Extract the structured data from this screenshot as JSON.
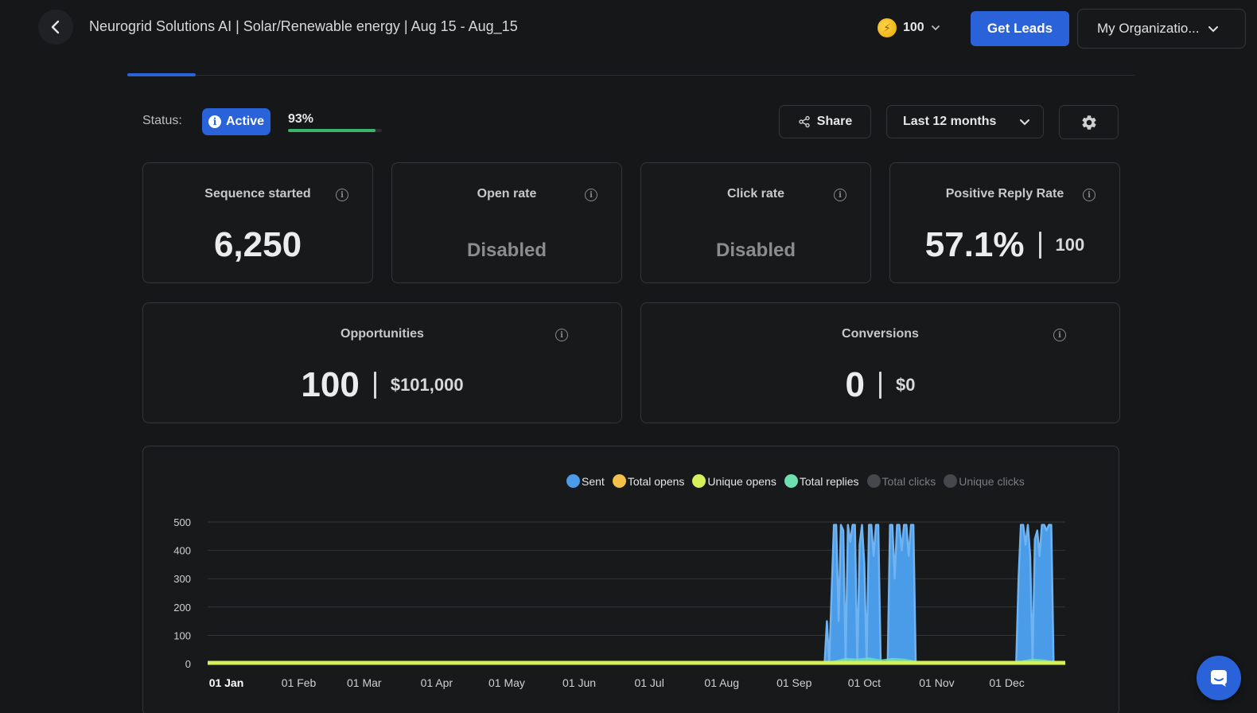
{
  "header": {
    "title": "Neurogrid Solutions AI | Solar/Renewable energy | Aug 15 - Aug_15",
    "credits": "100",
    "get_leads_label": "Get Leads",
    "org_label": "My Organizatio..."
  },
  "status": {
    "label": "Status:",
    "badge": "Active",
    "progress_label": "93%",
    "progress": 0.93
  },
  "toolbar": {
    "share_label": "Share",
    "range_label": "Last 12 months"
  },
  "cards": {
    "sequence": {
      "title": "Sequence started",
      "value": "6,250"
    },
    "open_rate": {
      "title": "Open rate",
      "value": "Disabled"
    },
    "click_rate": {
      "title": "Click rate",
      "value": "Disabled"
    },
    "positive_reply": {
      "title": "Positive Reply Rate",
      "value": "57.1%",
      "secondary": "100"
    },
    "opportunities": {
      "title": "Opportunities",
      "value": "100",
      "secondary": "$101,000"
    },
    "conversions": {
      "title": "Conversions",
      "value": "0",
      "secondary": "$0"
    }
  },
  "colors": {
    "accent": "#2a62d9",
    "sent": "#4a9be8",
    "total_opens": "#f5c04a",
    "unique_opens": "#d7f05a",
    "total_replies": "#6ee0b0",
    "disabled": "#44484c"
  },
  "chart_data": {
    "type": "area",
    "legend": [
      {
        "name": "Sent",
        "color": "#4a9be8",
        "active": true
      },
      {
        "name": "Total opens",
        "color": "#f5c04a",
        "active": true
      },
      {
        "name": "Unique opens",
        "color": "#d7f05a",
        "active": true
      },
      {
        "name": "Total replies",
        "color": "#6ee0b0",
        "active": true
      },
      {
        "name": "Total clicks",
        "color": "#44484c",
        "active": false
      },
      {
        "name": "Unique clicks",
        "color": "#44484c",
        "active": false
      }
    ],
    "x_ticks": [
      "01 Jan",
      "01 Feb",
      "01 Mar",
      "01 Apr",
      "01 May",
      "01 Jun",
      "01 Jul",
      "01 Aug",
      "01 Sep",
      "01 Oct",
      "01 Nov",
      "01 Dec"
    ],
    "y_ticks": [
      0,
      100,
      200,
      300,
      400,
      500
    ],
    "ylim": [
      0,
      500
    ],
    "xlim_days": [
      -8,
      359
    ],
    "series": [
      {
        "name": "Sent",
        "points": [
          [
            256,
            0
          ],
          [
            257,
            150
          ],
          [
            258,
            0
          ],
          [
            260,
            490
          ],
          [
            261,
            490
          ],
          [
            262,
            150
          ],
          [
            263,
            490
          ],
          [
            264,
            470
          ],
          [
            265,
            0
          ],
          [
            266,
            490
          ],
          [
            267,
            430
          ],
          [
            268,
            490
          ],
          [
            269,
            490
          ],
          [
            270,
            0
          ],
          [
            271,
            420
          ],
          [
            272,
            490
          ],
          [
            273,
            350
          ],
          [
            274,
            0
          ],
          [
            275,
            490
          ],
          [
            276,
            490
          ],
          [
            277,
            380
          ],
          [
            278,
            490
          ],
          [
            279,
            490
          ],
          [
            280,
            0
          ],
          [
            283,
            0
          ],
          [
            284,
            490
          ],
          [
            285,
            490
          ],
          [
            286,
            300
          ],
          [
            287,
            490
          ],
          [
            288,
            490
          ],
          [
            289,
            400
          ],
          [
            290,
            490
          ],
          [
            291,
            490
          ],
          [
            292,
            380
          ],
          [
            293,
            490
          ],
          [
            294,
            490
          ],
          [
            295,
            0
          ],
          [
            338,
            0
          ],
          [
            339,
            300
          ],
          [
            340,
            490
          ],
          [
            341,
            490
          ],
          [
            342,
            420
          ],
          [
            343,
            490
          ],
          [
            344,
            380
          ],
          [
            345,
            0
          ],
          [
            346,
            440
          ],
          [
            347,
            470
          ],
          [
            348,
            380
          ],
          [
            349,
            490
          ],
          [
            350,
            490
          ],
          [
            351,
            470
          ],
          [
            352,
            490
          ],
          [
            353,
            490
          ],
          [
            354,
            0
          ]
        ]
      },
      {
        "name": "Total replies",
        "points": [
          [
            260,
            10
          ],
          [
            265,
            20
          ],
          [
            270,
            18
          ],
          [
            275,
            22
          ],
          [
            280,
            15
          ],
          [
            285,
            20
          ],
          [
            290,
            18
          ],
          [
            295,
            10
          ],
          [
            325,
            5
          ],
          [
            330,
            8
          ],
          [
            340,
            10
          ],
          [
            345,
            18
          ],
          [
            350,
            15
          ],
          [
            354,
            8
          ]
        ]
      }
    ]
  }
}
